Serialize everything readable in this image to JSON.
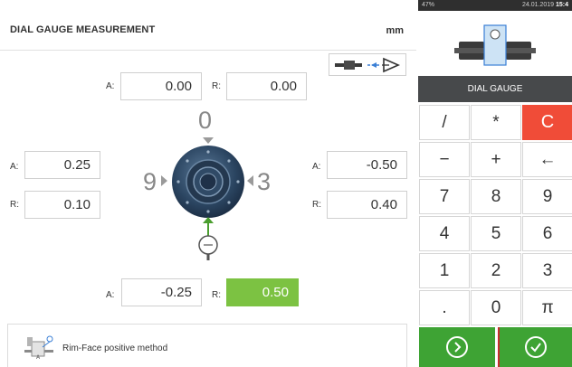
{
  "header": {
    "title": "DIAL GAUGE MEASUREMENT",
    "unit": "mm"
  },
  "top_reading": {
    "a_label": "A:",
    "a_value": "0.00",
    "r_label": "R:",
    "r_value": "0.00"
  },
  "left_reading": {
    "a_label": "A:",
    "a_value": "0.25",
    "r_label": "R:",
    "r_value": "0.10"
  },
  "right_reading": {
    "a_label": "A:",
    "a_value": "-0.50",
    "r_label": "R:",
    "r_value": "0.40"
  },
  "bottom_reading": {
    "a_label": "A:",
    "a_value": "-0.25",
    "r_label": "R:",
    "r_value": "0.50"
  },
  "clock_positions": {
    "top": "0",
    "left": "9",
    "right": "3"
  },
  "method": {
    "label": "Rim-Face positive method"
  },
  "status_bar": {
    "battery": "47%",
    "date": "24.01.2019",
    "time": "15:4"
  },
  "panel": {
    "mode_label": "DIAL GAUGE"
  },
  "keypad": {
    "keys": [
      "/",
      "*",
      "C",
      "−",
      "+",
      "←",
      "7",
      "8",
      "9",
      "4",
      "5",
      "6",
      "1",
      "2",
      "3",
      ".",
      "0",
      "π"
    ]
  },
  "colors": {
    "accent_green": "#7cc242",
    "ok_green": "#3ea334",
    "clear_red": "#f04c38",
    "mode_bar": "#47494b"
  },
  "icons": [
    "rim-face-method-icon",
    "coupling-preview-icon",
    "next-arrow-icon",
    "confirm-check-icon",
    "dial-gauge-icon",
    "backspace-arrow-icon"
  ]
}
